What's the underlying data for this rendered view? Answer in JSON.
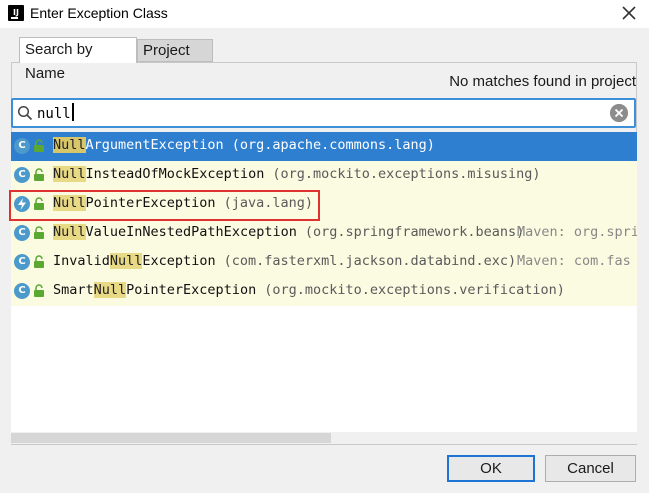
{
  "window": {
    "title": "Enter Exception Class",
    "app_icon_text": "IJ"
  },
  "tabs": [
    {
      "label": "Search by Name",
      "active": true
    },
    {
      "label": "Project",
      "active": false
    }
  ],
  "status_text": "No matches found in project",
  "search": {
    "value": "null"
  },
  "results": [
    {
      "highlight": "Null",
      "rest": "ArgumentException",
      "package": "(org.apache.commons.lang)",
      "maven": "",
      "icon": "class-icon",
      "selected": true
    },
    {
      "highlight": "Null",
      "rest": "InsteadOfMockException",
      "package": "(org.mockito.exceptions.misusing)",
      "maven": "",
      "icon": "class-icon",
      "selected": false
    },
    {
      "highlight": "Null",
      "rest": "PointerException",
      "package": "(java.lang)",
      "maven": "",
      "icon": "exception-class-icon",
      "selected": false
    },
    {
      "highlight": "Null",
      "rest": "ValueInNestedPathException",
      "package": "(org.springframework.beans)",
      "maven": "Maven: org.spring",
      "icon": "class-icon",
      "selected": false
    },
    {
      "prefix": "Invalid",
      "highlight": "Null",
      "rest": "Exception",
      "package": "(com.fasterxml.jackson.databind.exc)",
      "maven": "Maven: com.fas",
      "icon": "class-icon",
      "selected": false
    },
    {
      "prefix": "Smart",
      "highlight": "Null",
      "rest": "PointerException",
      "package": "(org.mockito.exceptions.verification)",
      "maven": "",
      "icon": "class-icon",
      "selected": false
    }
  ],
  "buttons": {
    "ok": "OK",
    "cancel": "Cancel"
  },
  "colors": {
    "selection": "#2f7fd1",
    "row_bg": "#fbfbe2",
    "highlight_box": "#e03131",
    "focus": "#3d8fd8"
  }
}
